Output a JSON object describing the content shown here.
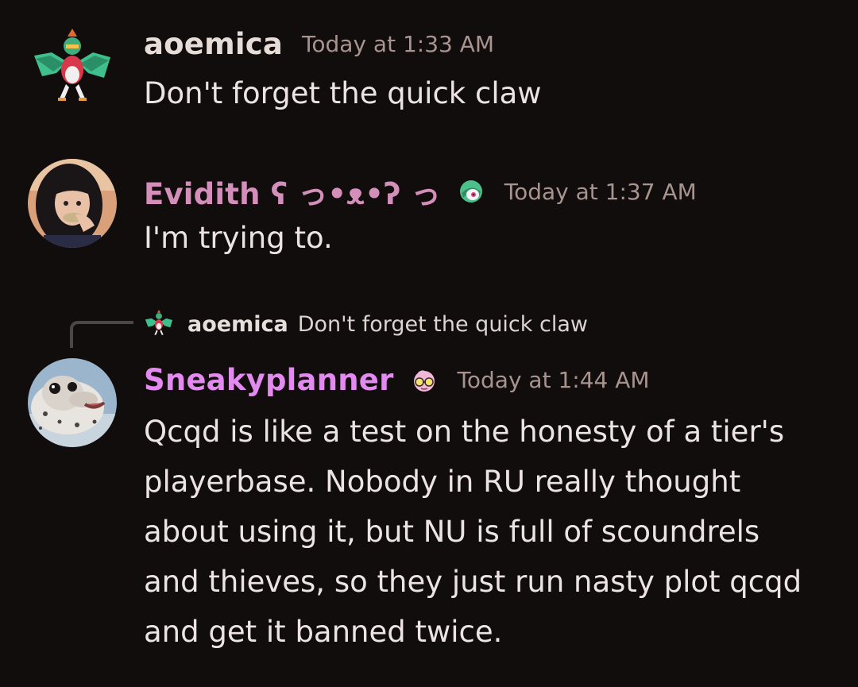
{
  "messages": [
    {
      "username": "aoemica",
      "username_color": "#e6ddd9",
      "avatar": "hawlucha-sprite-icon",
      "timestamp": "Today at 1:33 AM",
      "text": "Don't forget the quick claw"
    },
    {
      "username": "Evidith ʕ っ•ᴥ•ʔ っ",
      "username_color": "#d38fb9",
      "avatar": "user-photo-avatar",
      "role_icon": "gardevoir-icon",
      "timestamp": "Today at 1:37 AM",
      "text": "I'm trying to."
    },
    {
      "reply": {
        "username": "aoemica",
        "text": "Don't forget the quick claw",
        "avatar": "hawlucha-sprite-icon"
      },
      "username": "Sneakyplanner",
      "username_color": "#e38af0",
      "avatar": "seal-photo-avatar",
      "role_icon": "jigglypuff-sunglasses-icon",
      "timestamp": "Today at 1:44 AM",
      "text_lines": [
        "Qcqd is like a test on the honesty of a tier's",
        "playerbase. Nobody in RU really thought",
        "about using it, but NU is full of scoundrels",
        "and thieves, so they just run nasty plot qcqd",
        "and get it banned twice."
      ]
    }
  ],
  "colors": {
    "background": "#110d0c",
    "timestamp": "#a8948f",
    "message_text": "#ece4e2"
  }
}
